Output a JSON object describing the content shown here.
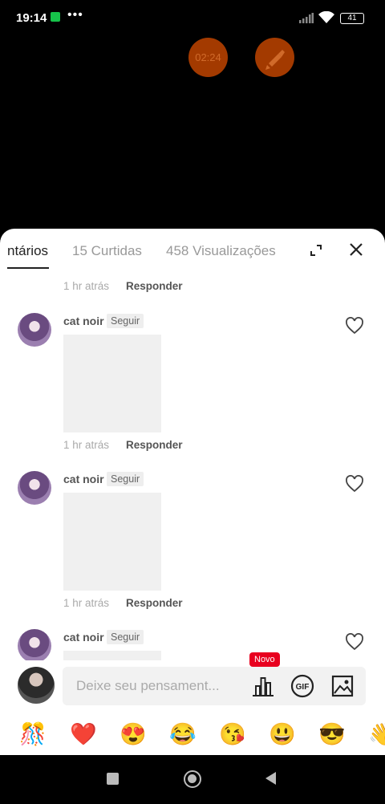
{
  "status_bar": {
    "time": "19:14",
    "more": "•••",
    "battery": "41"
  },
  "overlay": {
    "timer": "02:24"
  },
  "tabs": [
    {
      "label": "ntários"
    },
    {
      "label": "15 Curtidas"
    },
    {
      "label": "458 Visualizações"
    }
  ],
  "comments": {
    "first_meta": {
      "time": "1 hr atrás",
      "reply": "Responder"
    },
    "items": [
      {
        "username": "cat noir",
        "follow": "Seguir",
        "time": "1 hr atrás",
        "reply": "Responder"
      },
      {
        "username": "cat noir",
        "follow": "Seguir",
        "time": "1 hr atrás",
        "reply": "Responder"
      },
      {
        "username": "cat noir",
        "follow": "Seguir"
      }
    ]
  },
  "input": {
    "placeholder": "Deixe seu pensament...",
    "new_badge": "Novo",
    "gif_label": "GIF"
  },
  "emojis": [
    "🎊",
    "❤️",
    "😍",
    "😂",
    "😘",
    "😃",
    "😎",
    "👋"
  ],
  "colors": {
    "badge": "#e8001f",
    "fab": "#a33a00",
    "sheet": "#ffffff"
  }
}
